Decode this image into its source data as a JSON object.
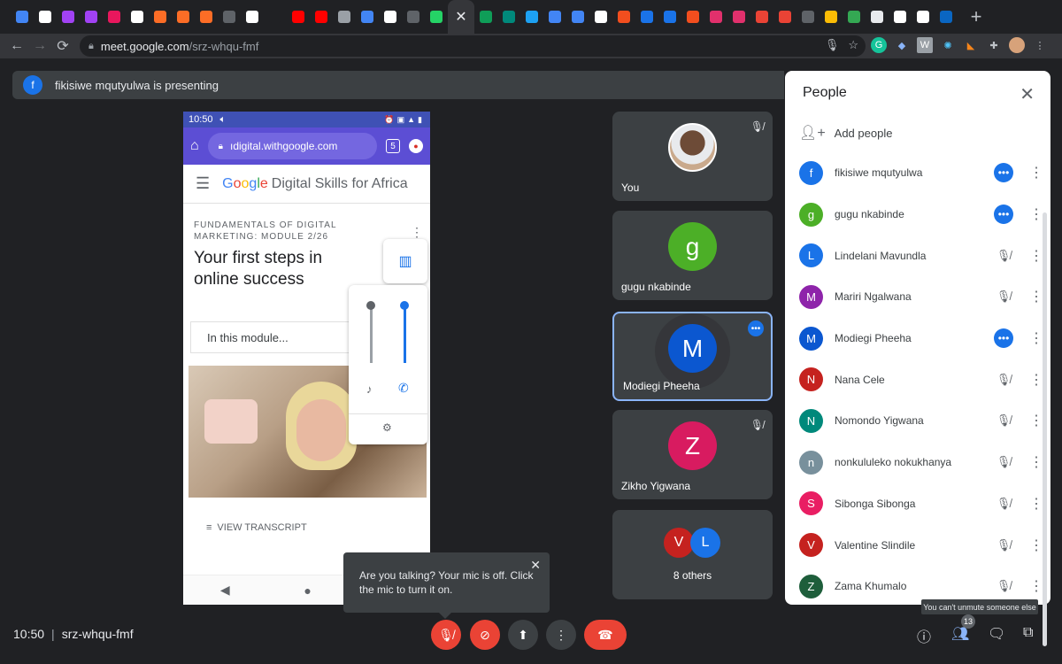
{
  "browser": {
    "favicons": [
      {
        "name": "tab-1",
        "color": "#4285f4"
      },
      {
        "name": "tab-2",
        "color": "#ffffff"
      },
      {
        "name": "tab-3",
        "color": "#a142f4"
      },
      {
        "name": "tab-4",
        "color": "#a142f4"
      },
      {
        "name": "tab-5",
        "color": "#e8175d"
      },
      {
        "name": "tab-6",
        "color": "#ffffff"
      },
      {
        "name": "tab-7",
        "color": "#fc6d26"
      },
      {
        "name": "tab-8",
        "color": "#fc6d26"
      },
      {
        "name": "tab-9",
        "color": "#fc6d26"
      },
      {
        "name": "tab-10",
        "color": "#5f6368"
      },
      {
        "name": "tab-11",
        "color": "#ffffff"
      },
      {
        "name": "tab-12",
        "color": "#202124"
      },
      {
        "name": "tab-13",
        "color": "#ff0000"
      },
      {
        "name": "tab-14",
        "color": "#ff0000"
      },
      {
        "name": "tab-15",
        "color": "#9aa0a6"
      },
      {
        "name": "tab-16",
        "color": "#4285f4"
      },
      {
        "name": "tab-17",
        "color": "#ffffff"
      },
      {
        "name": "tab-18",
        "color": "#5f6368"
      },
      {
        "name": "tab-19",
        "color": "#25d366"
      }
    ],
    "favicons_after": [
      {
        "name": "tab-21",
        "color": "#0f9d58"
      },
      {
        "name": "tab-22",
        "color": "#00897b"
      },
      {
        "name": "tab-23",
        "color": "#1da1f2"
      },
      {
        "name": "tab-24",
        "color": "#4285f4"
      },
      {
        "name": "tab-25",
        "color": "#4285f4"
      },
      {
        "name": "tab-26",
        "color": "#ffffff"
      },
      {
        "name": "tab-27",
        "color": "#f24e1e"
      },
      {
        "name": "tab-28",
        "color": "#1a73e8"
      },
      {
        "name": "tab-29",
        "color": "#1a73e8"
      },
      {
        "name": "tab-30",
        "color": "#f24e1e"
      },
      {
        "name": "tab-31",
        "color": "#e1306c"
      },
      {
        "name": "tab-32",
        "color": "#e1306c"
      },
      {
        "name": "tab-33",
        "color": "#ea4335"
      },
      {
        "name": "tab-34",
        "color": "#ea4335"
      },
      {
        "name": "tab-35",
        "color": "#5f6368"
      },
      {
        "name": "tab-36",
        "color": "#fbbc05"
      },
      {
        "name": "tab-37",
        "color": "#34a853"
      },
      {
        "name": "tab-38",
        "color": "#e8eaed"
      },
      {
        "name": "tab-39",
        "color": "#ffffff"
      },
      {
        "name": "tab-40",
        "color": "#ffffff"
      },
      {
        "name": "tab-41",
        "color": "#0a66c2"
      }
    ],
    "active_tab_close": "✕",
    "new_tab": "+",
    "url_host": "meet.google.com",
    "url_path": "/srz-whqu-fmf"
  },
  "banner": {
    "avatar_letter": "f",
    "text": "fikisiwe mqutyulwa is presenting"
  },
  "phone": {
    "time": "10:50",
    "url": "ıdigital.withgoogle.com",
    "tab_count": "5",
    "brand_google": [
      "G",
      "o",
      "o",
      "g",
      "l",
      "e"
    ],
    "brand_rest": "Digital Skills for Africa",
    "module": "FUNDAMENTALS OF DIGITAL MARKETING: MODULE 2/26",
    "title": "Your first steps in online success",
    "in_module": "In this module...",
    "transcript": "VIEW TRANSCRIPT"
  },
  "tiles": [
    {
      "name": "You"
    },
    {
      "name": "gugu nkabinde",
      "letter": "g",
      "color": "#4caf27"
    },
    {
      "name": "Modiegi Pheeha",
      "letter": "M",
      "color": "#0b57d0"
    },
    {
      "name": "Zikho Yigwana",
      "letter": "Z",
      "color": "#d81b60"
    },
    {
      "name": "8 others",
      "letters": [
        "V",
        "L"
      ],
      "colors": [
        "#c5221f",
        "#1a73e8"
      ]
    }
  ],
  "people": {
    "title": "People",
    "add_label": "Add people",
    "list": [
      {
        "letter": "f",
        "name": "fikisiwe mqutyulwa",
        "color": "#1a73e8",
        "status": "active"
      },
      {
        "letter": "g",
        "name": "gugu nkabinde",
        "color": "#4caf27",
        "status": "active"
      },
      {
        "letter": "L",
        "name": "Lindelani Mavundla",
        "color": "#1a73e8",
        "status": "muted"
      },
      {
        "letter": "M",
        "name": "Mariri Ngalwana",
        "color": "#8e24aa",
        "status": "muted"
      },
      {
        "letter": "M",
        "name": "Modiegi Pheeha",
        "color": "#0b57d0",
        "status": "active"
      },
      {
        "letter": "N",
        "name": "Nana Cele",
        "color": "#c5221f",
        "status": "muted"
      },
      {
        "letter": "N",
        "name": "Nomondo Yigwana",
        "color": "#00897b",
        "status": "muted"
      },
      {
        "letter": "n",
        "name": "nonkululeko nokukhanya",
        "color": "#78909c",
        "status": "muted"
      },
      {
        "letter": "S",
        "name": "Sibonga Sibonga",
        "color": "#e91e63",
        "status": "muted"
      },
      {
        "letter": "V",
        "name": "Valentine Slindile",
        "color": "#c5221f",
        "status": "muted"
      },
      {
        "letter": "Z",
        "name": "Zama Khumalo",
        "color": "#1e5e3b",
        "status": "muted"
      }
    ]
  },
  "toast": {
    "text": "Are you talking? Your mic is off. Click the mic to turn it on."
  },
  "tooltip": "You can't unmute someone else",
  "bottom": {
    "time": "10:50",
    "meeting_code": "srz-whqu-fmf",
    "people_count": "13"
  }
}
